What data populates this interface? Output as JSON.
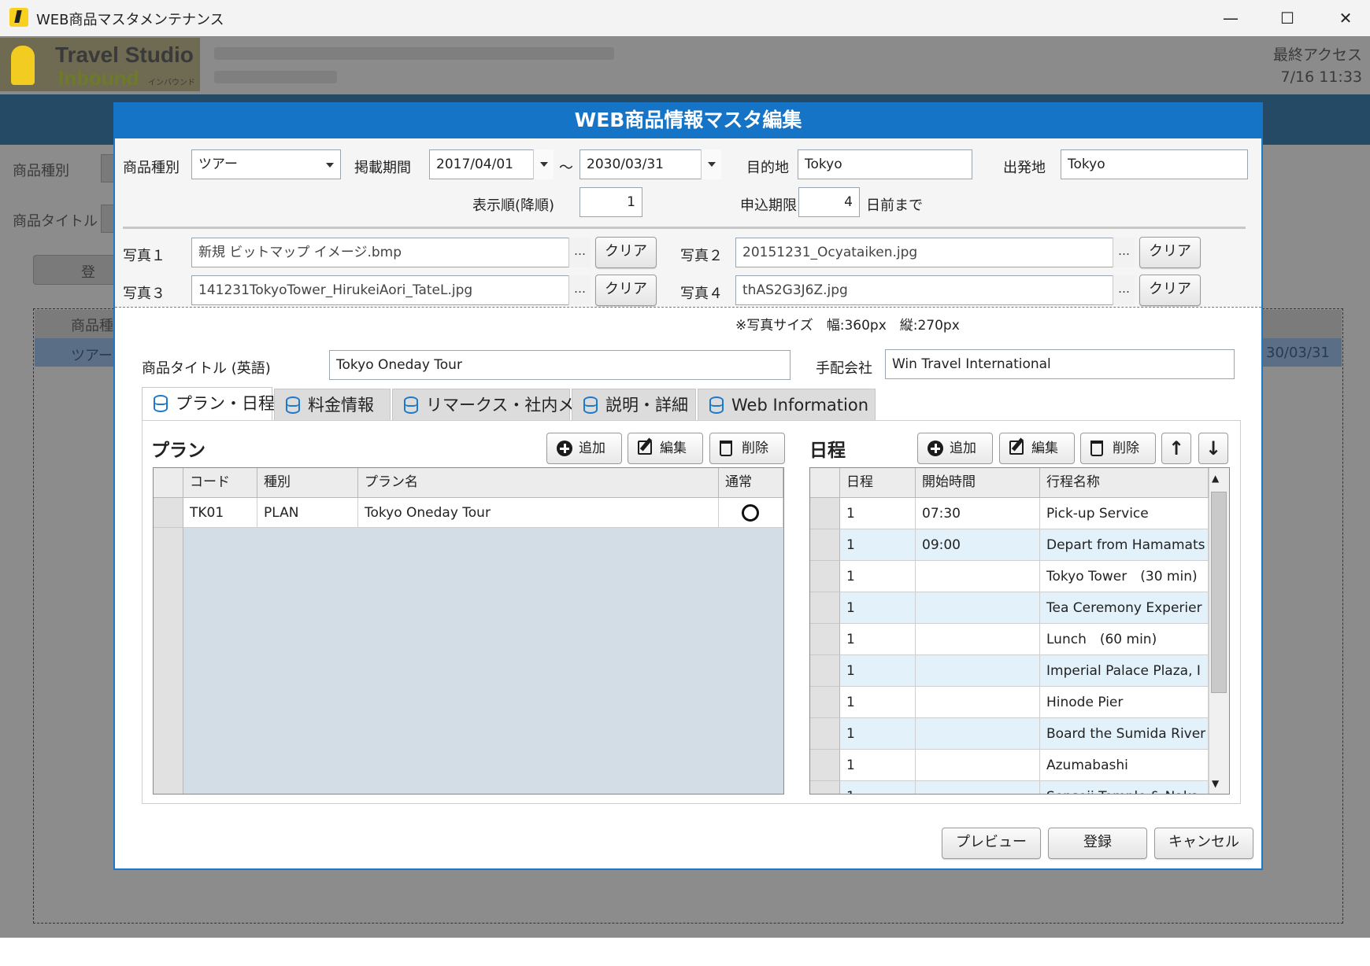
{
  "window": {
    "title": "WEB商品マスタメンテナンス",
    "minimize": "—",
    "maximize": "☐",
    "close": "✕"
  },
  "header": {
    "logo_line1": "Travel Studio",
    "logo_line2": "Inbound",
    "logo_sub": "インバウンド",
    "last_access_label": "最終アクセス",
    "last_access_time": "7/16 11:33"
  },
  "background": {
    "label_type": "商品種別",
    "label_title": "商品タイトル",
    "register_btn": "登",
    "grid_header": "商品種",
    "row_value": "ツアー",
    "row_end_date": "30/03/31"
  },
  "dialog": {
    "title": "WEB商品情報マスタ編集",
    "product_type_label": "商品種別",
    "product_type_value": "ツアー",
    "period_label": "掲載期間",
    "period_from": "2017/04/01",
    "period_tilde": "～",
    "period_to": "2030/03/31",
    "destination_label": "目的地",
    "destination_value": "Tokyo",
    "departure_label": "出発地",
    "departure_value": "Tokyo",
    "display_order_label": "表示順(降順)",
    "display_order_value": "1",
    "deadline_label": "申込期限",
    "deadline_value": "4",
    "deadline_suffix": "日前まで",
    "photo1_label": "写真１",
    "photo1_value": "新規 ビットマップ イメージ.bmp",
    "photo2_label": "写真２",
    "photo2_value": "20151231_Ocyataiken.jpg",
    "photo3_label": "写真３",
    "photo3_value": "141231TokyoTower_HirukeiAori_TateL.jpg",
    "photo4_label": "写真４",
    "photo4_value": "thAS2G3J6Z.jpg",
    "browse": "…",
    "clear_label": "クリア",
    "photo_size_note": "※写真サイズ　幅:360px　縦:270px",
    "title_en_label": "商品タイトル (英語)",
    "title_en_value": "Tokyo Oneday Tour",
    "agency_label": "手配会社",
    "agency_value": "Win Travel International",
    "preview_btn": "プレビュー",
    "register_btn": "登録",
    "cancel_btn": "キャンセル"
  },
  "tabs": [
    {
      "label": "プラン・日程"
    },
    {
      "label": "料金情報"
    },
    {
      "label": "リマークス・社内メモ"
    },
    {
      "label": "説明・詳細"
    },
    {
      "label": "Web Information"
    }
  ],
  "plan": {
    "title": "プラン",
    "add_label": "追加",
    "edit_label": "編集",
    "delete_label": "削除",
    "columns": [
      "コード",
      "種別",
      "プラン名",
      "通常"
    ],
    "rows": [
      {
        "code": "TK01",
        "type": "PLAN",
        "name": "Tokyo Oneday Tour",
        "normal": "○"
      }
    ]
  },
  "schedule": {
    "title": "日程",
    "add_label": "追加",
    "edit_label": "編集",
    "delete_label": "削除",
    "up": "↑",
    "down": "↓",
    "columns": [
      "日程",
      "開始時間",
      "行程名称"
    ],
    "rows": [
      {
        "day": "1",
        "time": "07:30",
        "name": "Pick-up Service"
      },
      {
        "day": "1",
        "time": "09:00",
        "name": "Depart from Hamamats"
      },
      {
        "day": "1",
        "time": "",
        "name": "Tokyo Tower　(30 min)"
      },
      {
        "day": "1",
        "time": "",
        "name": "Tea Ceremony Experier"
      },
      {
        "day": "1",
        "time": "",
        "name": "Lunch　(60 min)"
      },
      {
        "day": "1",
        "time": "",
        "name": "Imperial Palace Plaza, I"
      },
      {
        "day": "1",
        "time": "",
        "name": "Hinode Pier"
      },
      {
        "day": "1",
        "time": "",
        "name": "Board the Sumida River"
      },
      {
        "day": "1",
        "time": "",
        "name": "Azumabashi"
      },
      {
        "day": "1",
        "time": "",
        "name": "Sensoji Temple & Naka"
      }
    ],
    "scroll_up": "▲",
    "scroll_down": "▼"
  },
  "colors": {
    "dialog_accent": "#1574c6",
    "header_band": "#244a66",
    "logo_yellow": "#f2cc20",
    "selected_row": "#e3f1fb"
  }
}
